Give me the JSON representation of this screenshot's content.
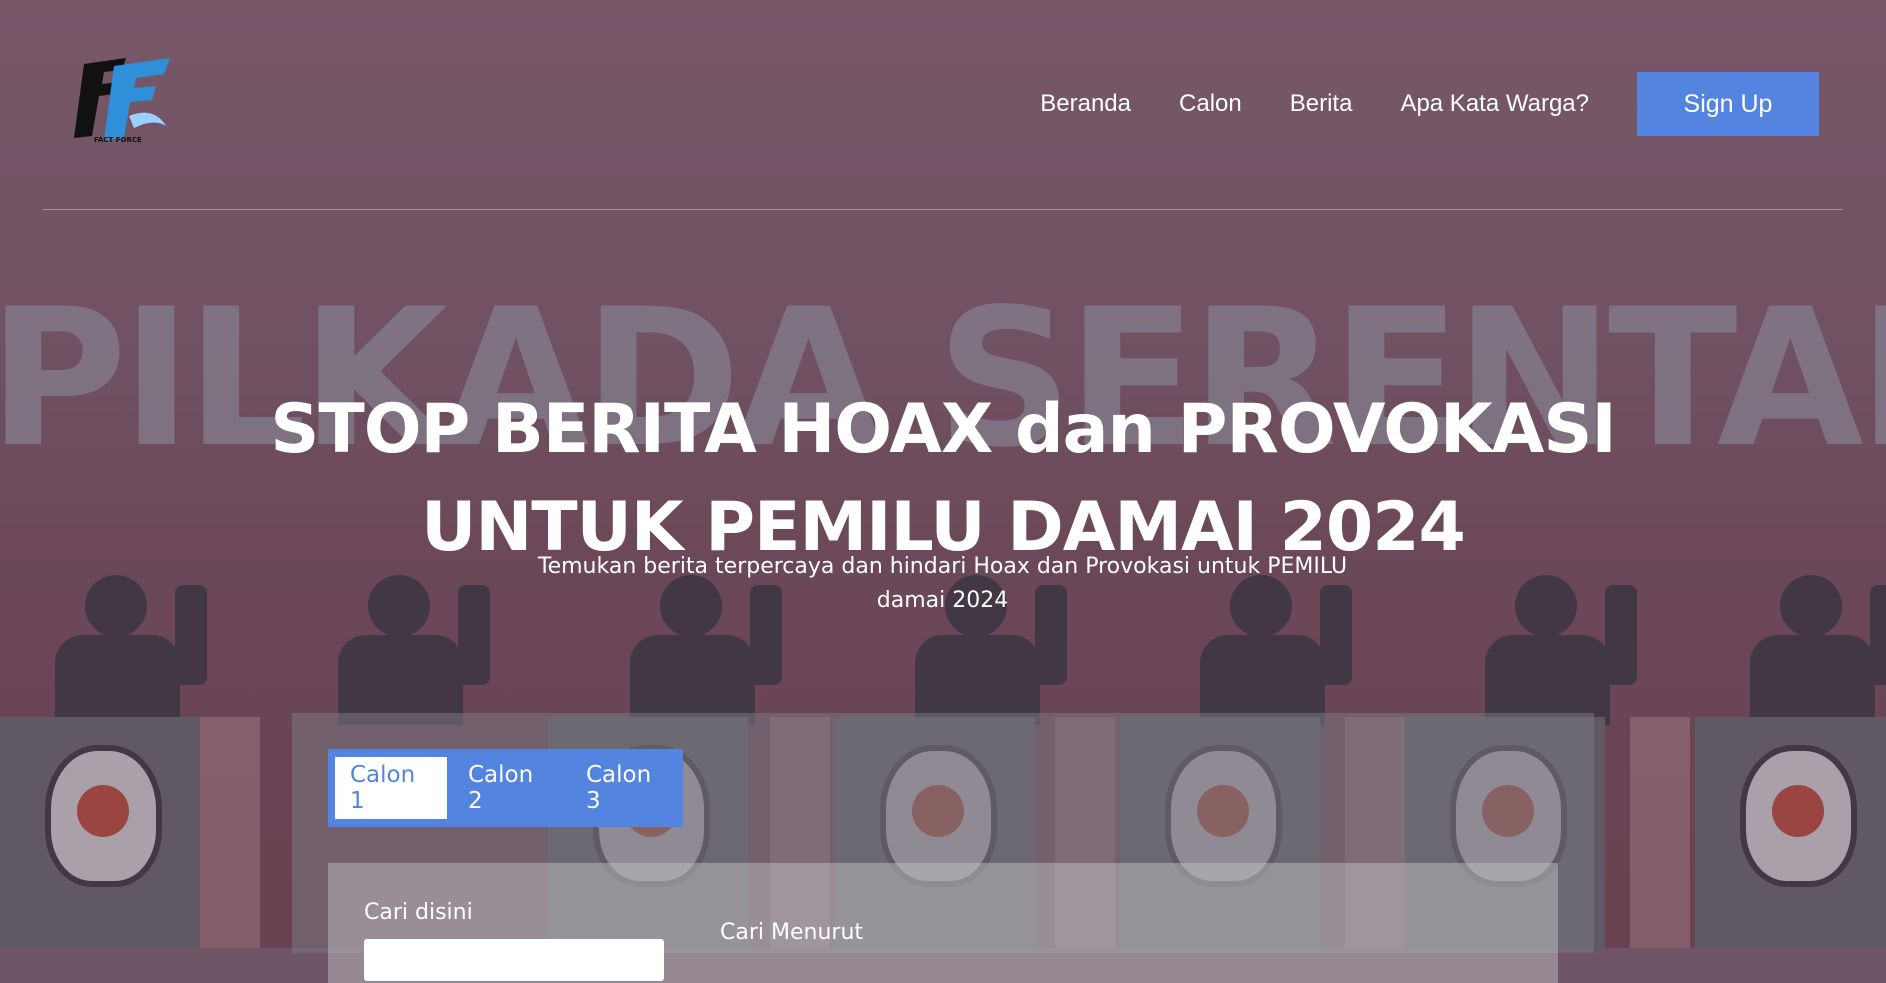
{
  "brand": {
    "logo_text": "FACT FORCE"
  },
  "nav": {
    "links": [
      "Beranda",
      "Calon",
      "Berita",
      "Apa Kata Warga?"
    ],
    "signup_label": "Sign Up"
  },
  "hero": {
    "bg_word": "PILKADA SERENTAK",
    "title_line1": "STOP BERITA HOAX dan PROVOKASI",
    "title_line2": "UNTUK PEMILU DAMAI 2024",
    "subtitle": "Temukan berita terpercaya dan hindari Hoax dan Provokasi untuk PEMILU damai 2024"
  },
  "search": {
    "tabs": [
      "Calon 1",
      "Calon 2",
      "Calon 3"
    ],
    "active_tab": "Calon 1",
    "search_label": "Cari disini",
    "filter_label": "Cari Menurut",
    "search_value": ""
  },
  "colors": {
    "accent": "#5384df",
    "text": "#ffffff"
  }
}
